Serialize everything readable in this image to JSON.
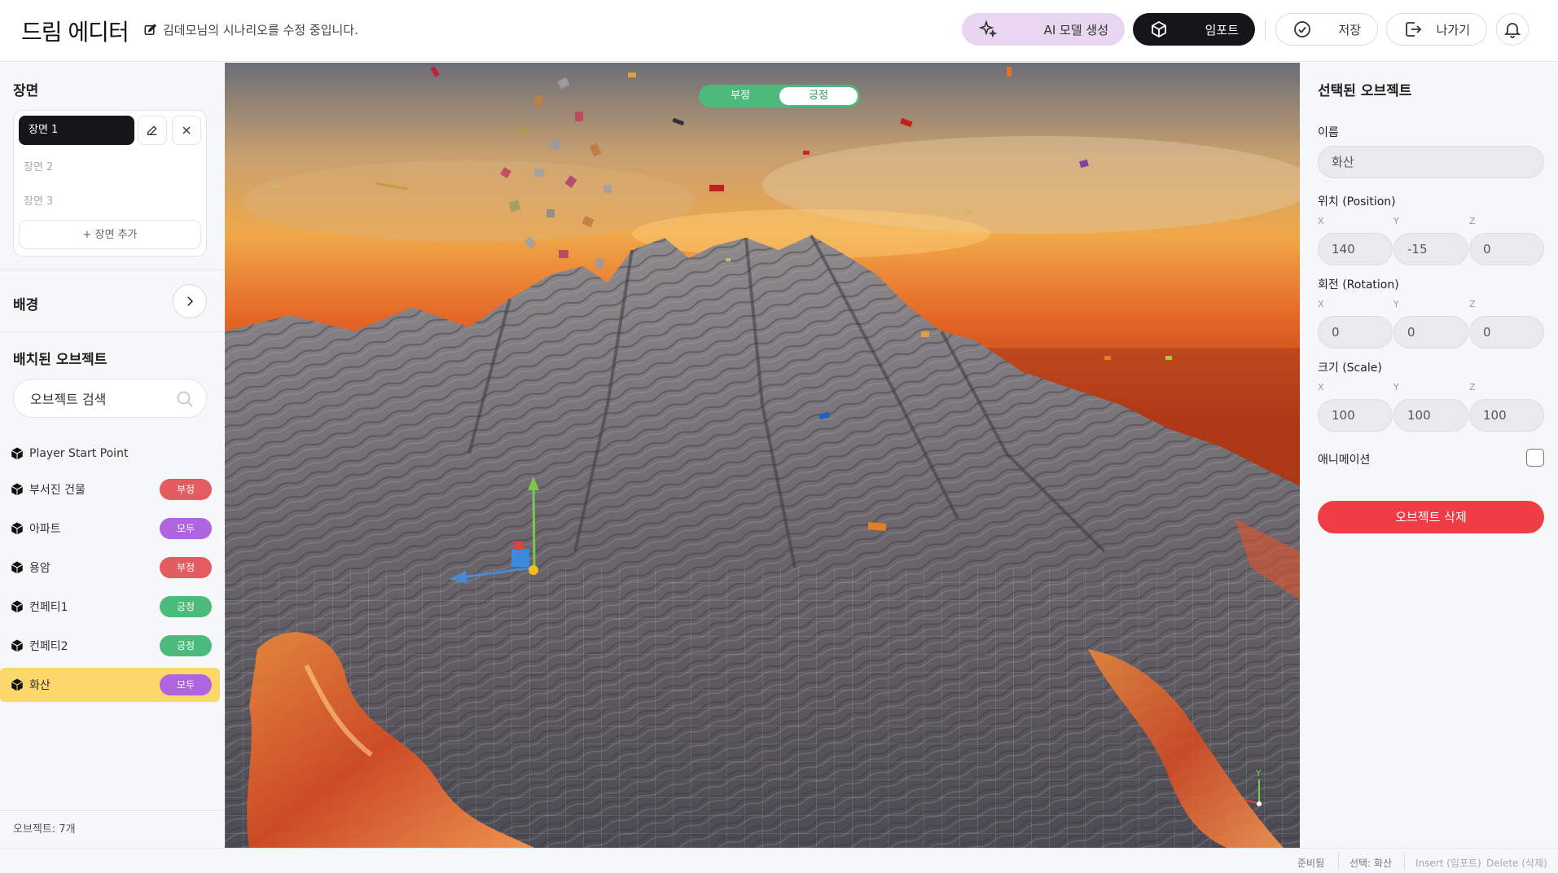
{
  "header": {
    "title": "드림 에디터",
    "edit_note": "김데모님의 시나리오를 수정 중입니다.",
    "ai_button": "AI 모델 생성",
    "import_button": "임포트",
    "save_button": "저장",
    "exit_button": "나가기"
  },
  "scenes": {
    "title": "장면",
    "active": "장면 1",
    "items": [
      "장면 2",
      "장면 3"
    ],
    "add_button": "+ 장면 추가"
  },
  "background": {
    "title": "배경"
  },
  "objects": {
    "title": "배치된 오브젝트",
    "search_placeholder": "오브젝트 검색",
    "items": [
      {
        "name": "Player Start Point",
        "badge": ""
      },
      {
        "name": "부서진 건물",
        "badge": "부정"
      },
      {
        "name": "아파트",
        "badge": "모두"
      },
      {
        "name": "용암",
        "badge": "부정"
      },
      {
        "name": "컨페티1",
        "badge": "긍정"
      },
      {
        "name": "컨페티2",
        "badge": "긍정"
      },
      {
        "name": "화산",
        "badge": "모두"
      }
    ],
    "count_label": "오브젝트: 7개"
  },
  "viewport": {
    "toggle": {
      "negative": "부정",
      "positive": "긍정",
      "selected": "긍정"
    },
    "gizmo_axis_label": "Y"
  },
  "inspector": {
    "title": "선택된 오브젝트",
    "name_label": "이름",
    "name_value": "화산",
    "position_label": "위치 (Position)",
    "rotation_label": "회전 (Rotation)",
    "scale_label": "크기 (Scale)",
    "axes": [
      "X",
      "Y",
      "Z"
    ],
    "position": [
      "140",
      "-15",
      "0"
    ],
    "rotation": [
      "0",
      "0",
      "0"
    ],
    "scale": [
      "100",
      "100",
      "100"
    ],
    "animation_label": "애니메이션",
    "animation_checked": false,
    "delete_button": "오브젝트 삭제"
  },
  "status": {
    "ready": "준비됨",
    "selection": "선택: 화산",
    "insert_hint": "Insert (임포트)",
    "delete_hint": "Delete (삭제)"
  },
  "colors": {
    "accent_dark": "#16161a",
    "ai_button_bg": "#e8d5ef",
    "badge_negative": "#e35c60",
    "badge_positive": "#4cba7c",
    "badge_all": "#b065e0",
    "selected_row": "#fcd76b",
    "delete_button": "#ee3d45"
  }
}
